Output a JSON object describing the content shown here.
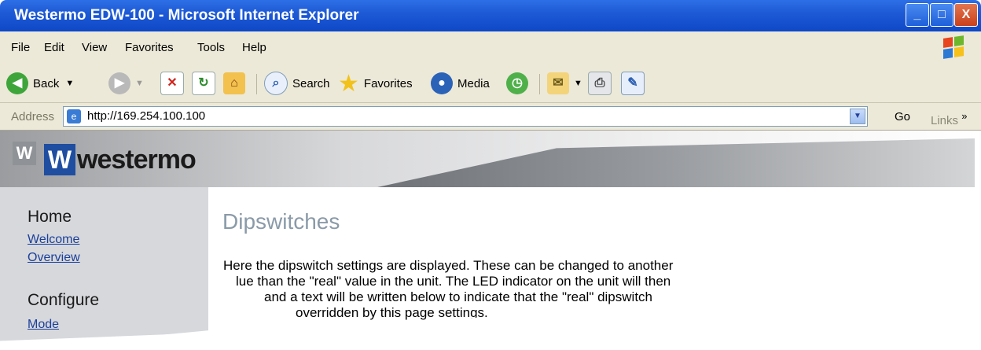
{
  "window": {
    "title": "Westermo EDW-100 - Microsoft Internet Explorer",
    "buttons": {
      "minimize": "_",
      "maximize": "□",
      "close": "X"
    }
  },
  "menu": [
    "File",
    "Edit",
    "View",
    "Favorites",
    "Tools",
    "Help"
  ],
  "toolbar": {
    "back": "Back",
    "search": "Search",
    "favorites": "Favorites",
    "media": "Media"
  },
  "address": {
    "label": "Address",
    "url": "http://169.254.100.100",
    "go": "Go",
    "links": "Links",
    "links_more": "»"
  },
  "brand": {
    "mark": "W",
    "logo_letter": "W",
    "logo_name": "westermo"
  },
  "sidebar": {
    "sections": [
      {
        "heading": "Home",
        "links": [
          "Welcome",
          "Overview"
        ]
      },
      {
        "heading": "Configure",
        "links": [
          "Mode"
        ]
      }
    ]
  },
  "main": {
    "heading": "Dipswitches",
    "paragraph_lines": [
      "Here the dipswitch settings are displayed. These can be changed to another",
      "lue than the \"real\" value in the unit. The LED indicator on the unit will then",
      "and a text will be written below to indicate that the \"real\" dipswitch",
      "overridden by this page settings."
    ]
  },
  "colors": {
    "titlebar": "#1e5ad6",
    "chrome": "#ece9d8",
    "brand_blue": "#1f4ea1",
    "link": "#1b3f9a",
    "heading": "#8a9aa8"
  }
}
